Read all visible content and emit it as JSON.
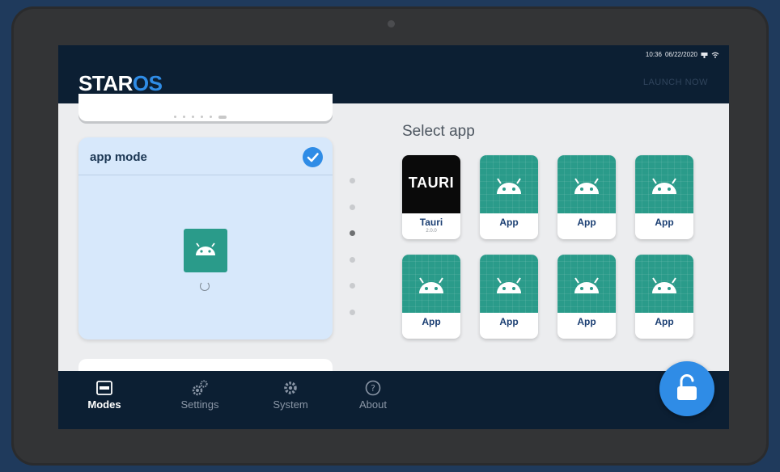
{
  "header": {
    "logo_star": "STAR",
    "logo_os": "OS",
    "time": "10:36",
    "date": "06/22/2020",
    "launch_label": "LAUNCH NOW"
  },
  "mode_panel": {
    "card_title": "app mode",
    "pager_active_index": 2
  },
  "app_grid": {
    "title": "Select app",
    "apps": [
      {
        "label": "Tauri",
        "version": "2.0.0",
        "logo_text": "TAURI"
      },
      {
        "label": "App"
      },
      {
        "label": "App"
      },
      {
        "label": "App"
      },
      {
        "label": "App"
      },
      {
        "label": "App"
      },
      {
        "label": "App"
      },
      {
        "label": "App"
      }
    ]
  },
  "nav": {
    "items": [
      {
        "label": "Modes",
        "icon": "modes-icon",
        "active": true
      },
      {
        "label": "Settings",
        "icon": "settings-icon"
      },
      {
        "label": "System",
        "icon": "gear-icon"
      },
      {
        "label": "About",
        "icon": "question-icon"
      }
    ]
  },
  "lock_button": {
    "icon": "unlock-icon"
  },
  "colors": {
    "bar_bg": "#0c1f33",
    "accent": "#2f8ce6",
    "app_icon_bg": "#2a9b8a",
    "selected_card_bg": "#d7e8fb"
  }
}
